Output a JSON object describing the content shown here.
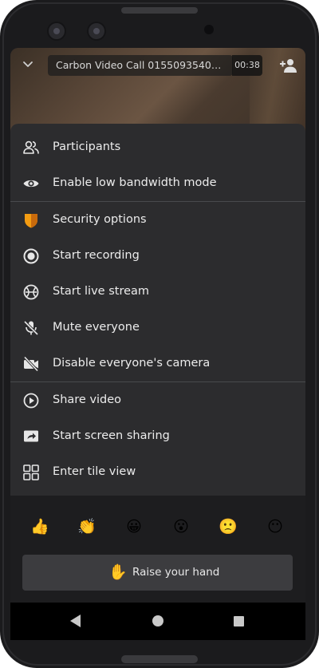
{
  "call": {
    "title": "Carbon Video Call 015509354040...",
    "timer": "00:38"
  },
  "menu": {
    "items": [
      {
        "label": "Participants",
        "icon": "participants-icon"
      },
      {
        "label": "Enable low bandwidth mode",
        "icon": "eye-icon"
      },
      {
        "label": "Security options",
        "icon": "shield-icon"
      },
      {
        "label": "Start recording",
        "icon": "record-icon"
      },
      {
        "label": "Start live stream",
        "icon": "live-stream-icon"
      },
      {
        "label": "Mute everyone",
        "icon": "mic-off-icon"
      },
      {
        "label": "Disable everyone's camera",
        "icon": "camera-off-icon"
      },
      {
        "label": "Share video",
        "icon": "play-circle-icon"
      },
      {
        "label": "Start screen sharing",
        "icon": "screen-share-icon"
      },
      {
        "label": "Enter tile view",
        "icon": "tile-view-icon"
      }
    ]
  },
  "reactions": {
    "emojis": [
      "👍",
      "👏",
      "😀",
      "😮",
      "🙁",
      "😶"
    ],
    "raise_hand_icon": "✋",
    "raise_hand_label": "Raise your hand"
  },
  "colors": {
    "sheet_bg": "#2c2c2e",
    "reactions_bg": "#1d1d1f",
    "shield_orange": "#f39c12"
  }
}
